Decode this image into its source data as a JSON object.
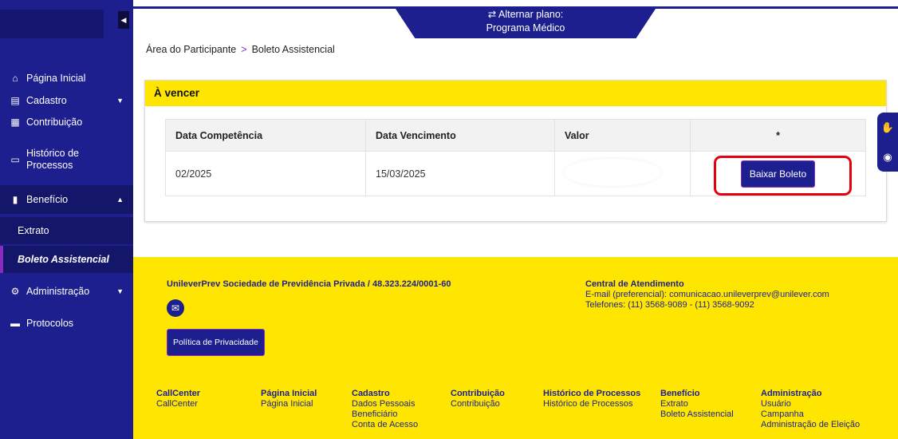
{
  "plan": {
    "switch_label": "⇄ Alternar plano:",
    "name": "Programa Médico"
  },
  "breadcrumb": {
    "root": "Área do Participante",
    "sep": ">",
    "current": "Boleto Assistencial"
  },
  "sidebar": {
    "items": [
      {
        "label": "Página Inicial",
        "icon": "home-icon"
      },
      {
        "label": "Cadastro",
        "icon": "id-card-icon"
      },
      {
        "label": "Contribuição",
        "icon": "calculator-icon"
      },
      {
        "label": "Histórico de Processos",
        "icon": "document-icon"
      },
      {
        "label": "Benefício",
        "icon": "clipboard-icon"
      },
      {
        "label": "Extrato"
      },
      {
        "label": "Boleto Assistencial"
      },
      {
        "label": "Administração",
        "icon": "users-cog-icon"
      },
      {
        "label": "Protocolos",
        "icon": "archive-icon"
      }
    ]
  },
  "card": {
    "title": "À vencer",
    "headers": [
      "Data Competência",
      "Data Vencimento",
      "Valor",
      "*"
    ],
    "row": {
      "competencia": "02/2025",
      "vencimento": "15/03/2025",
      "valor": ""
    },
    "action_label": "Baixar Boleto"
  },
  "footer": {
    "company": "UnileverPrev Sociedade de Previdência Privada / 48.323.224/0001-60",
    "privacy_label": "Política de Privacidade",
    "central_title": "Central de Atendimento",
    "central_email": "E-mail (preferencial): comunicacao.unileverprev@unilever.com",
    "central_phones": "Telefones: (11) 3568-9089 - (11) 3568-9092",
    "columns": [
      {
        "title": "CallCenter",
        "links": [
          "CallCenter"
        ]
      },
      {
        "title": "Página Inicial",
        "links": [
          "Página Inicial"
        ]
      },
      {
        "title": "Cadastro",
        "links": [
          "Dados Pessoais",
          "Beneficiário",
          "Conta de Acesso"
        ]
      },
      {
        "title": "Contribuição",
        "links": [
          "Contribuição"
        ]
      },
      {
        "title": "Histórico de Processos",
        "links": [
          "Histórico de Processos"
        ]
      },
      {
        "title": "Benefício",
        "links": [
          "Extrato",
          "Boleto Assistencial"
        ]
      },
      {
        "title": "Administração",
        "links": [
          "Usuário",
          "Campanha",
          "Administração de Eleição"
        ]
      }
    ]
  },
  "colors": {
    "brand": "#1d1f8f",
    "accent": "#ffe600",
    "highlight": "#e3000f"
  }
}
